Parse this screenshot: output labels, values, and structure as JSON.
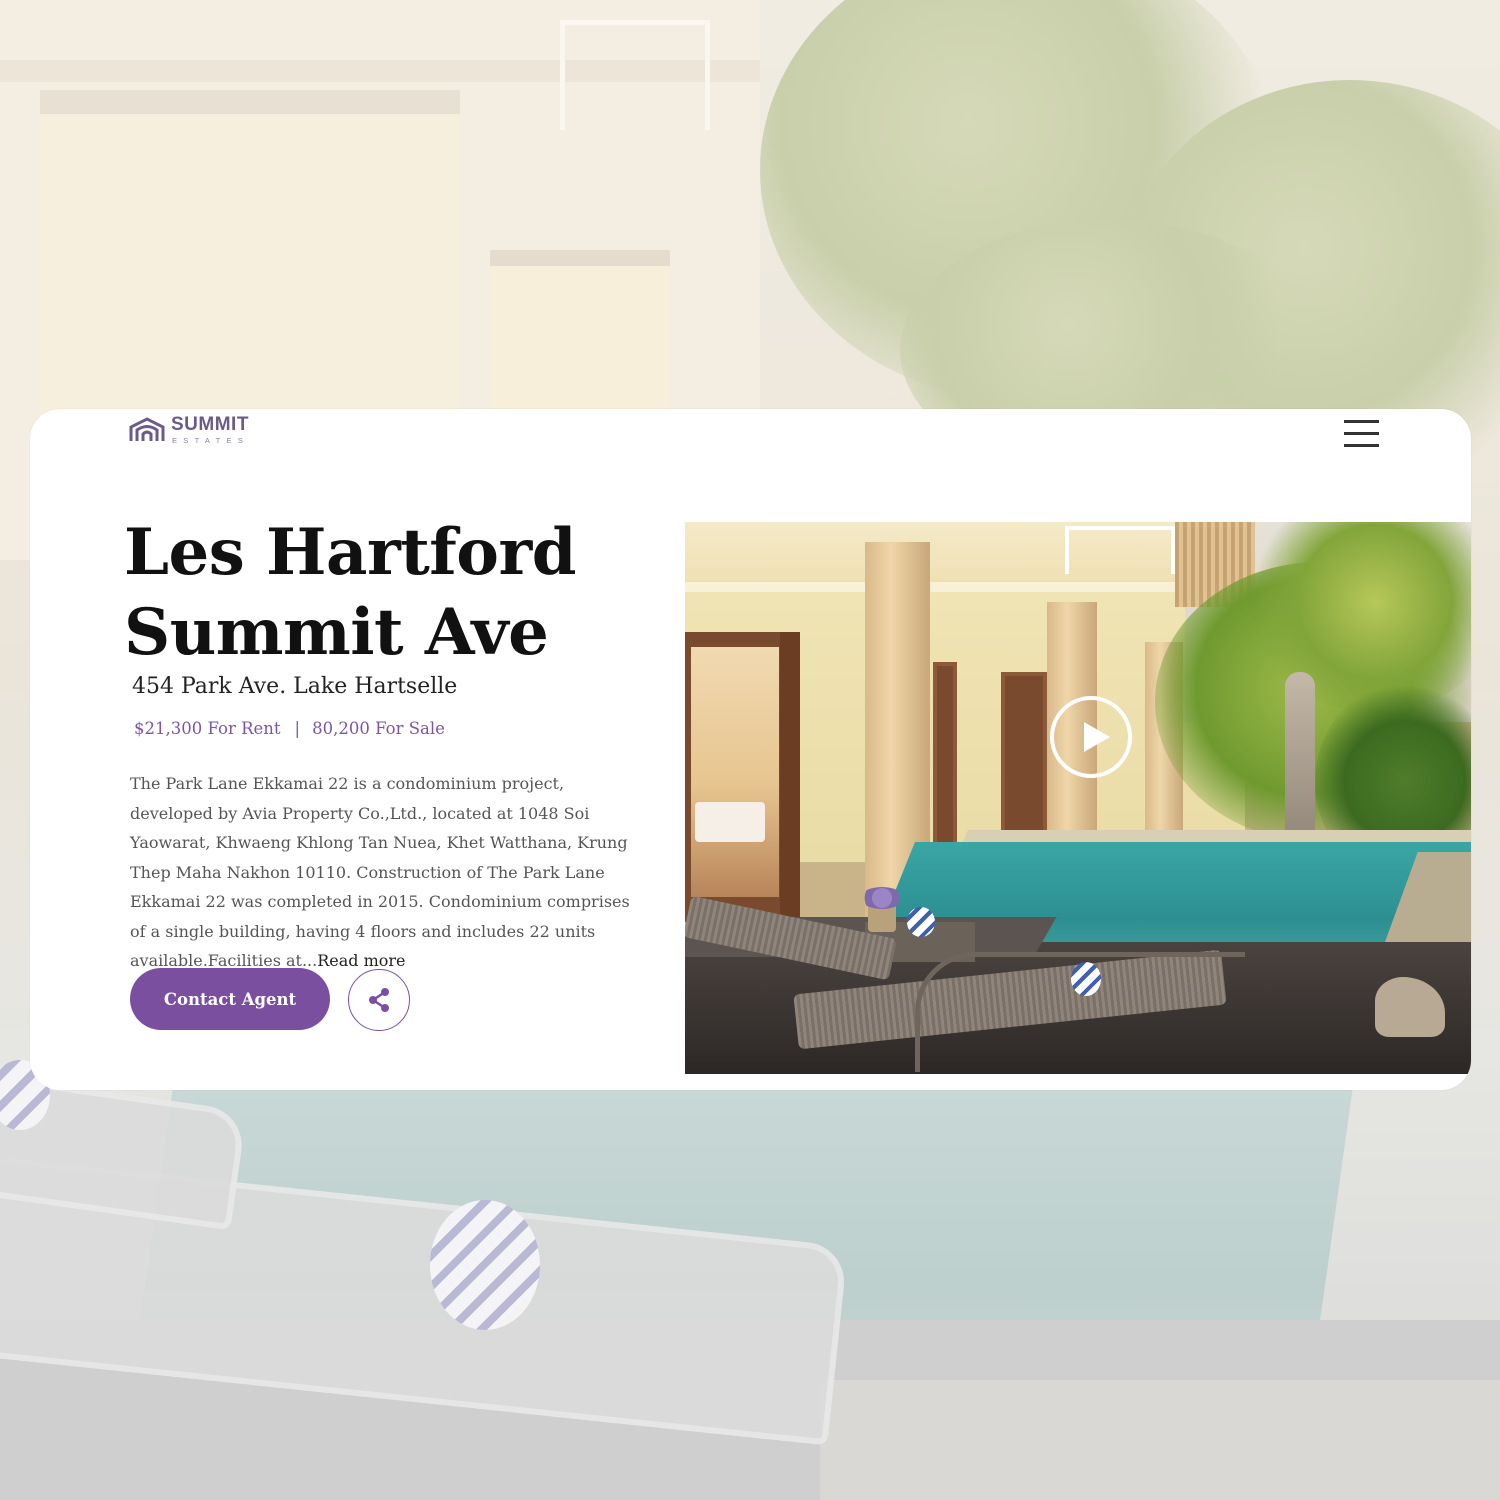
{
  "brand": {
    "name": "SUMMIT",
    "subtitle": "ESTATES",
    "logo_icon": "house-arch-icon",
    "color": "#6b5b8a"
  },
  "nav": {
    "menu_icon": "hamburger-menu-icon"
  },
  "listing": {
    "title_line1": "Les Hartford",
    "title_line2": "Summit Ave",
    "address": "454 Park Ave. Lake Hartselle",
    "price_rent": "$21,300 For Rent",
    "price_separator": "|",
    "price_sale": "80,200 For Sale",
    "description": "The Park Lane Ekkamai 22 is a condominium project, developed by Avia Property Co.,Ltd., located at 1048 Soi Yaowarat, Khwaeng Khlong Tan Nuea, Khet Watthana, Krung Thep Maha Nakhon 10110. Construction of The Park Lane Ekkamai 22 was completed in 2015. Condominium comprises of a single building, having 4 floors and includes 22 units available.Facilities at...",
    "read_more": "Read more"
  },
  "actions": {
    "contact_label": "Contact Agent",
    "share_icon": "share-icon",
    "play_icon": "play-icon"
  },
  "colors": {
    "accent": "#7b4fa0",
    "price_text": "#7b56a8",
    "card_bg": "#ffffff"
  }
}
